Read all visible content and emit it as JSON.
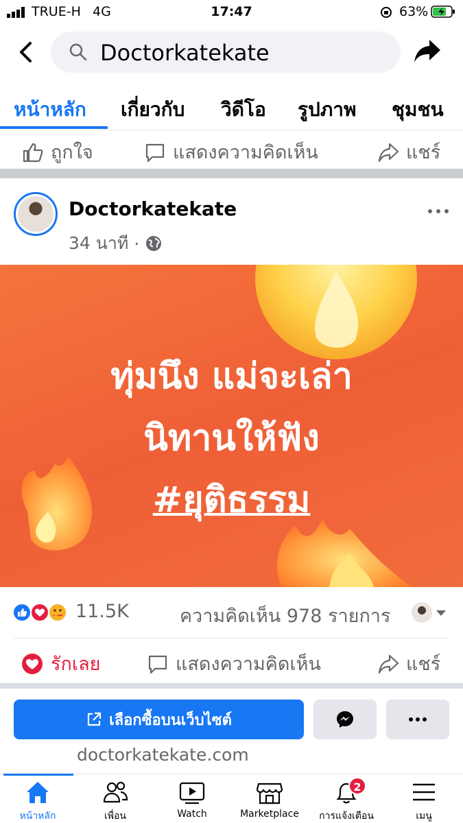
{
  "status_bar": {
    "carrier": "TRUE-H",
    "network": "4G",
    "time": "17:47",
    "battery": "63%"
  },
  "header": {
    "search_text": "Doctorkatekate"
  },
  "tabs": [
    {
      "label": "หน้าหลัก",
      "active": true
    },
    {
      "label": "เกี่ยวกับ"
    },
    {
      "label": "วิดีโอ"
    },
    {
      "label": "รูปภาพ"
    },
    {
      "label": "ชุมชน"
    }
  ],
  "prev_post_actions": {
    "like": "ถูกใจ",
    "comment": "แสดงความคิดเห็น",
    "share": "แชร์"
  },
  "post": {
    "page_name": "Doctorkatekate",
    "time": "34 นาที",
    "separator": "·",
    "banner_lines": [
      "ทุ่มนึง แม่จะเล่า",
      "นิทานให้ฟัง",
      "#ยุติธรรม"
    ],
    "reaction_count": "11.5K",
    "comment_count": "ความคิดเห็น 978 รายการ",
    "actions": {
      "love": "รักเลย",
      "comment": "แสดงความคิดเห็น",
      "share": "แชร์"
    },
    "cta_label": "เลือกซื้อบนเว็บไซต์",
    "url": "doctorkatekate.com"
  },
  "bottom_nav": [
    {
      "label": "หน้าหลัก",
      "icon": "home-icon",
      "active": true
    },
    {
      "label": "เพื่อน",
      "icon": "friends-icon"
    },
    {
      "label": "Watch",
      "icon": "watch-icon"
    },
    {
      "label": "Marketplace",
      "icon": "marketplace-icon"
    },
    {
      "label": "การแจ้งเตือน",
      "icon": "bell-icon",
      "badge": "2"
    },
    {
      "label": "เมนู",
      "icon": "menu-icon"
    }
  ],
  "colors": {
    "accent": "#1877f2",
    "love": "#e41e3f",
    "banner": "#ef5f37"
  }
}
